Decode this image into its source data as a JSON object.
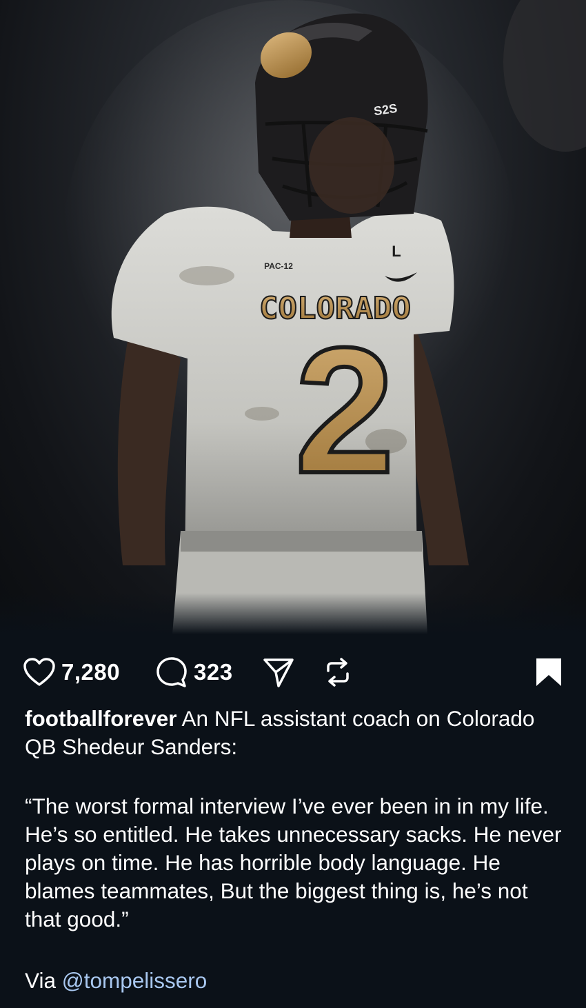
{
  "post": {
    "image": {
      "helmet_text": "S2S",
      "jersey_text": "COLORADO",
      "jersey_number": "2",
      "sleeve_letter": "L",
      "patch_text": "PAC-12"
    },
    "likes": "7,280",
    "comments": "323",
    "username": "footballforever",
    "caption_intro": "An NFL assistant coach on Colorado QB Shedeur Sanders:",
    "quote": "“The worst formal interview I’ve ever been in in my life. He’s so entitled. He takes unnecessary sacks. He never plays on time. He has horrible body language. He blames teammates, But the biggest thing is, he’s not that good.”",
    "via_label": "Via",
    "via_handle": "@tompelissero"
  },
  "icons": {
    "like": "heart-icon",
    "comment": "comment-icon",
    "share": "send-icon",
    "repost": "repost-icon",
    "save": "bookmark-icon"
  },
  "colors": {
    "background": "#0b1118",
    "text": "#ffffff",
    "mention": "#a9c8f0",
    "jersey_gold": "#b48a4a"
  }
}
